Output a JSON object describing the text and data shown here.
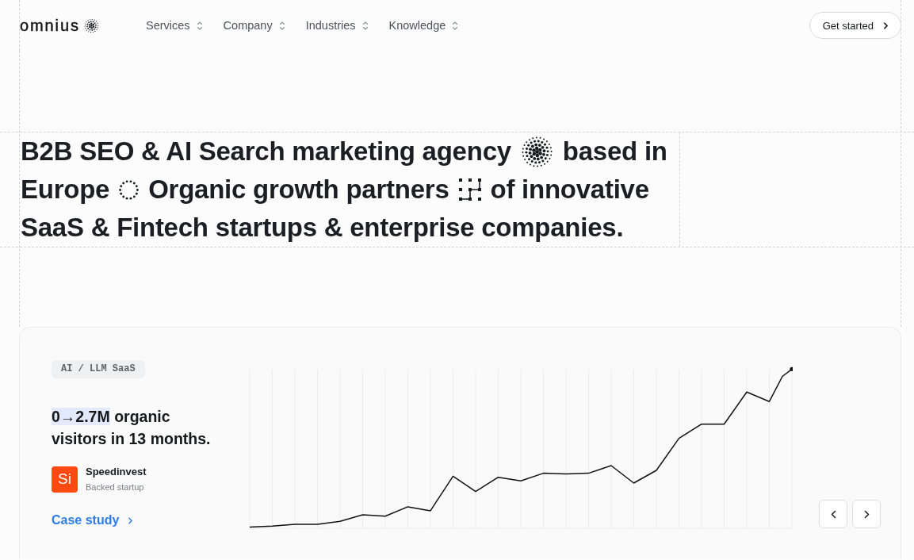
{
  "header": {
    "logo": "omnius",
    "nav": [
      {
        "label": "Services"
      },
      {
        "label": "Company"
      },
      {
        "label": "Industries"
      },
      {
        "label": "Knowledge"
      }
    ],
    "cta": "Get started"
  },
  "headline": {
    "lines": [
      [
        "B2B SEO & AI Search marketing agency",
        "based in"
      ],
      [
        "Europe",
        "Organic growth partners",
        "of innovative"
      ],
      [
        "SaaS & Fintech startups & enterprise companies."
      ]
    ]
  },
  "case_study": {
    "tag": "AI / LLM SaaS",
    "stat": {
      "highlight": "0→2.7M",
      "text": "organic visitors in 13 months."
    },
    "company": {
      "initials": "Si",
      "name": "Speedinvest",
      "note": "Backed startup"
    },
    "link": "Case study"
  }
}
